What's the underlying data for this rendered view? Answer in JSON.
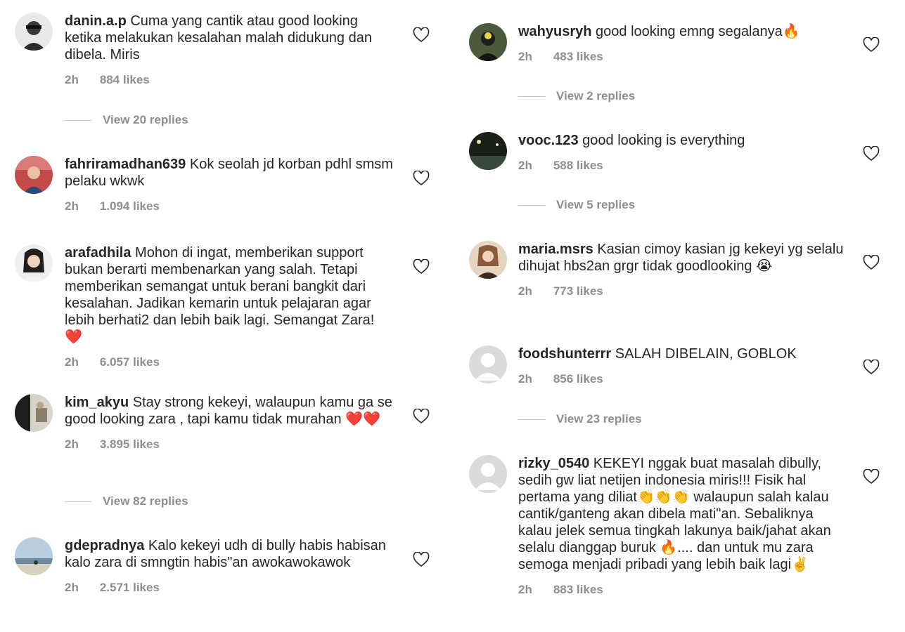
{
  "left": {
    "comments": [
      {
        "user": "danin.a.p",
        "text": "Cuma yang cantik atau good looking ketika melakukan kesalahan malah didukung dan dibela. Miris",
        "time": "2h",
        "likes": "884 likes",
        "replies": "View 20 replies"
      },
      {
        "user": "fahriramadhan639",
        "text": "Kok seolah jd korban pdhl smsm pelaku wkwk",
        "time": "2h",
        "likes": "1.094 likes"
      },
      {
        "user": "arafadhila",
        "text": "Mohon di ingat, memberikan support bukan berarti membenarkan yang salah. Tetapi memberikan semangat untuk berani bangkit dari kesalahan. Jadikan kemarin untuk pelajaran agar lebih berhati2 dan lebih baik lagi. Semangat Zara! ❤️",
        "time": "2h",
        "likes": "6.057 likes"
      },
      {
        "user": "kim_akyu",
        "text": "Stay strong kekeyi, walaupun kamu ga se good looking zara , tapi kamu tidak murahan ❤️❤️",
        "time": "2h",
        "likes": "3.895 likes",
        "replies": "View 82 replies"
      },
      {
        "user": "gdepradnya",
        "text": "Kalo kekeyi udh di bully habis habisan kalo zara di smngtin habis\"an awokawokawok",
        "time": "2h",
        "likes": "2.571 likes"
      }
    ]
  },
  "right": {
    "comments": [
      {
        "user": "wahyusryh",
        "text": "good looking emng segalanya🔥",
        "time": "2h",
        "likes": "483 likes",
        "replies": "View 2 replies"
      },
      {
        "user": "vooc.123",
        "text": "good looking is everything",
        "time": "2h",
        "likes": "588 likes",
        "replies": "View 5 replies"
      },
      {
        "user": "maria.msrs",
        "text": "Kasian cimoy kasian jg kekeyi yg selalu dihujat hbs2an grgr tidak goodlooking 😭",
        "time": "2h",
        "likes": "773 likes"
      },
      {
        "user": "foodshunterrr",
        "text": "SALAH DIBELAIN, GOBLOK",
        "time": "2h",
        "likes": "856 likes",
        "replies": "View 23 replies"
      },
      {
        "user": "rizky_0540",
        "text": "KEKEYI nggak buat masalah dibully, sedih gw liat netijen indonesia miris!!! Fisik hal pertama yang diliat👏👏👏 walaupun salah kalau cantik/ganteng akan dibela mati\"an. Sebaliknya kalau jelek semua tingkah lakunya baik/jahat akan selalu dianggap buruk 🔥.... dan untuk mu zara semoga menjadi pribadi yang lebih baik lagi✌️",
        "time": "2h",
        "likes": "883 likes"
      }
    ]
  },
  "icons": {
    "heart": "heart-outline-icon",
    "default_avatar": "default-avatar-icon"
  },
  "colors": {
    "text": "#262626",
    "muted": "#8e8e8e",
    "divider": "#c7c7c7"
  }
}
